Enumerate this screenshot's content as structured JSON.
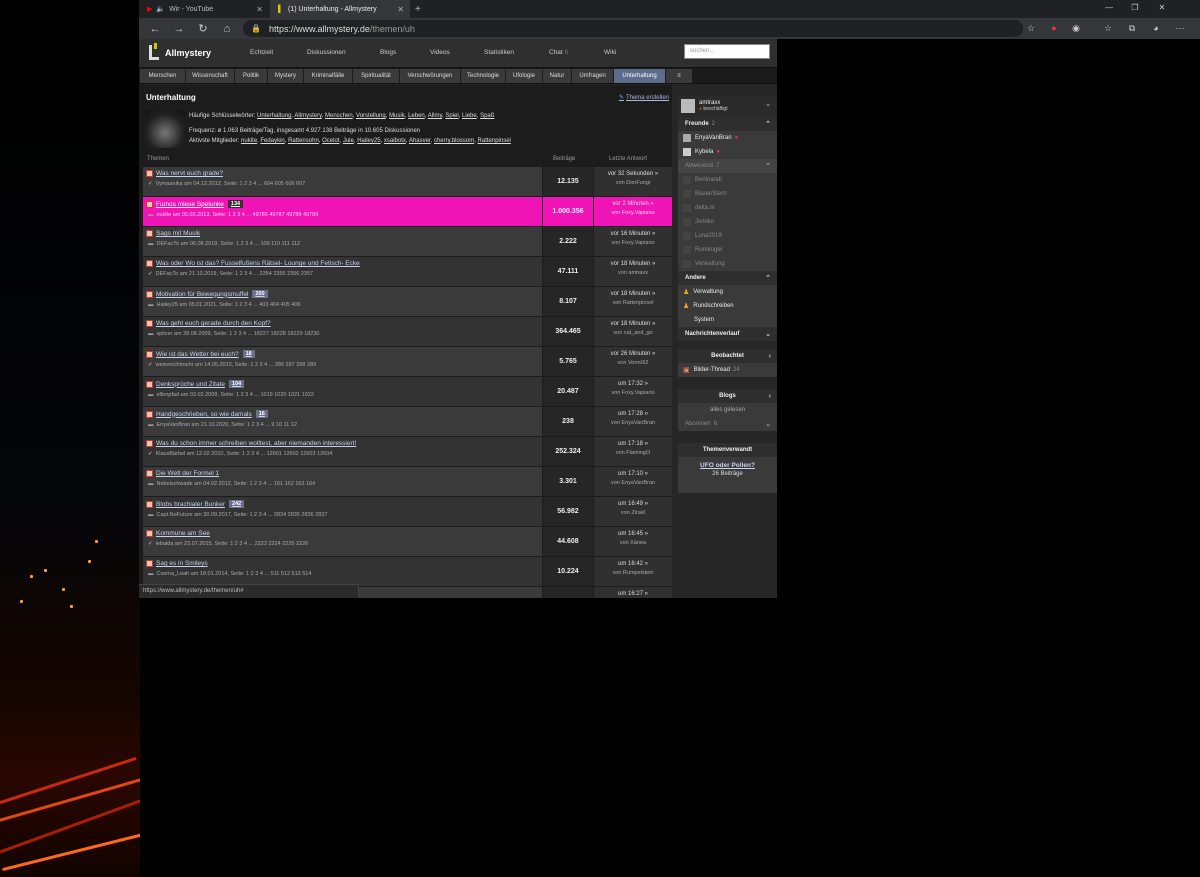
{
  "browser": {
    "tabs": [
      {
        "label": "Wir - YouTube"
      },
      {
        "label": "(1) Unterhaltung - Allmystery"
      }
    ],
    "url_host": "https://www.allmystery.de",
    "url_path": "/themen/uh",
    "status_url": "https://www.allmystery.de/themen/uh#"
  },
  "site": {
    "logo": "Allmystery",
    "topnav": [
      "Echtzeit",
      "Diskussionen",
      "Blogs",
      "Videos",
      "Statistiken",
      "Chat",
      "Wiki"
    ],
    "chat_count": "6",
    "search_placeholder": "suchen...",
    "categories": [
      "Menschen",
      "Wissenschaft",
      "Politik",
      "Mystery",
      "Kriminalfälle",
      "Spiritualität",
      "Verschwörungen",
      "Technologie",
      "Ufologie",
      "Natur",
      "Umfragen",
      "Unterhaltung",
      "≡"
    ],
    "active_category": "Unterhaltung"
  },
  "main": {
    "title": "Unterhaltung",
    "create_topic": "Thema erstellen",
    "keywords_label": "Häufige Schlüsselwörter:",
    "keywords": [
      "Unterhaltung",
      "Allmystery",
      "Menschen",
      "Vorstellung",
      "Musik",
      "Leben",
      "Allmy",
      "Spiel",
      "Liebe",
      "Spaß"
    ],
    "frequency_line": "Frequenz: ø 1.063 Beiträge/Tag, insgesamt 4.927.138 Beiträge in 10.605 Diskussionen",
    "active_label": "Aktivste Mitglieder:",
    "active_members": [
      "nukite",
      "Fedaykin",
      "Rattensohn",
      "Ocelot",
      "Jule",
      "Hailey25",
      "xsaibotx",
      "Ahasver",
      "cherry.blossom",
      "Rattenpinsel"
    ],
    "col_topics": "Themen",
    "col_posts": "Beiträge",
    "col_last": "Letzte Antwort",
    "rows": [
      {
        "title": "Was nervt euch grade?",
        "badge": "",
        "meta": "Vymaanika am 04.12.2012, Seite: 1 2 3 4 ... 604 605 606 607",
        "count": "12.135",
        "last": "vor 32 Sekunden »",
        "by": "von DonFungi"
      },
      {
        "title": "Fumos miese Spelunke",
        "badge": "134",
        "meta": "nukite am 05.02.2013, Seite: 1 2 3 4 ... 49786 49787 49788 49789",
        "count": "1.000.356",
        "last": "vor 2 Minuten »",
        "by": "von Foxy.Vapiano"
      },
      {
        "title": "Sags mit Musik",
        "badge": "",
        "meta": "DEFacTo am 06.08.2019, Seite: 1 2 3 4 ... 109 110 111 112",
        "count": "2.222",
        "last": "vor 16 Minuten »",
        "by": "von Foxy.Vapiano"
      },
      {
        "title": "Was oder Wo ist das? Fusselfußens Rätsel- Lounge und Fetisch- Ecke",
        "badge": "",
        "meta": "DEFacTo am 21.10.2019, Seite: 1 2 3 4 ... 2354 2355 2356 2357",
        "count": "47.111",
        "last": "vor 18 Minuten »",
        "by": "von amtraxx"
      },
      {
        "title": "Motivation für Bewegungsmuffel",
        "badge": "200",
        "meta": "Hailey25 am 05.01.2021, Seite: 1 2 3 4 ... 403 404 405 406",
        "count": "8.107",
        "last": "vor 18 Minuten »",
        "by": "von Rattenpinsel"
      },
      {
        "title": "Was geht euch gerade durch den Kopf?",
        "badge": "",
        "meta": "splicer am 28.08.2009, Seite: 1 2 3 4 ... 18227 18228 18229 18230",
        "count": "364.465",
        "last": "vor 18 Minuten »",
        "by": "von cat_and_go"
      },
      {
        "title": "Wie ist das Wetter bei euch?",
        "badge": "18",
        "meta": "weissnichtmehr am 14.05.2013, Seite: 1 2 3 4 ... 286 287 288 289",
        "count": "5.765",
        "last": "vor 26 Minuten »",
        "by": "von Vornü62"
      },
      {
        "title": "Denksprüche und Zitate",
        "badge": "104",
        "meta": "elfenpfad am 03.02.2008, Seite: 1 2 3 4 ... 1019 1020 1021 1022",
        "count": "20.487",
        "last": "um 17:32 »",
        "by": "von Foxy.Vapiano"
      },
      {
        "title": "Handgeschrieben, so wie damals",
        "badge": "16",
        "meta": "EnyaVanBran am 21.10.2020, Seite: 1 2 3 4 ... 9 10 11 12",
        "count": "238",
        "last": "um 17:28 »",
        "by": "von EnyaVanBran"
      },
      {
        "title": "Was du schon immer schreiben wolltest, aber niemanden interessiert!",
        "badge": "",
        "meta": "KlausBärbel am 12.02.2010, Seite: 1 2 3 4 ... 12601 12602 12603 12604",
        "count": "252.324",
        "last": "um 17:18 »",
        "by": "von FlamingO"
      },
      {
        "title": "Die Welt der Formel 1",
        "badge": "",
        "meta": "Nebelschwade am 04.02.2012, Seite: 1 2 3 4 ... 161 162 163 164",
        "count": "3.301",
        "last": "um 17:10 »",
        "by": "von EnyaVanBran"
      },
      {
        "title": "Blobs brachialer Bunker",
        "badge": "242",
        "meta": "Capt.NoFuture am 30.09.2017, Seite: 1 2 3 4 ... 2834 2835 2836 2837",
        "count": "56.982",
        "last": "um 16:49 »",
        "by": "von Ziraël"
      },
      {
        "title": "Kommune am See",
        "badge": "",
        "meta": "lebalda am 23.07.2015, Seite: 1 2 3 4 ... 2223 2224 2225 2226",
        "count": "44.608",
        "last": "um 16:45 »",
        "by": "von Xánea"
      },
      {
        "title": "Sag es in Smileys",
        "badge": "",
        "meta": "Cosma_Leah am 18.01.2014, Seite: 1 2 3 4 ... 511 512 513 514",
        "count": "10.224",
        "last": "um 16:42 »",
        "by": "von Rumpelstein"
      },
      {
        "title": "",
        "badge": "",
        "meta": "",
        "count": "",
        "last": "um 16:27 »",
        "by": ""
      }
    ]
  },
  "sidebar": {
    "user_name": "amtraxx",
    "user_status": "beschäftigt",
    "friends_label": "Freunde",
    "friends_count": "2",
    "friends": [
      "EnyaVanBran",
      "Kybela"
    ],
    "away_label": "Abwesend",
    "away_count": "7",
    "away": [
      "Berlinandi",
      "BlauerStern",
      "delta.m",
      "Jomiko",
      "Luna2019",
      "Rumkugel",
      "Verwaltung"
    ],
    "other_label": "Andere",
    "other": [
      "Verwaltung",
      "Rundschreiben",
      "System"
    ],
    "history_label": "Nachrichtenverlauf",
    "watched_label": "Beobachtet",
    "watched_item": "Bilder-Thread",
    "watched_count": "24",
    "blogs_label": "Blogs",
    "blogs_read": "alles gelesen",
    "subscribed_label": "Abonniert",
    "subscribed_count": "6",
    "related_label": "Themenverwandt",
    "related_title": "UFO oder Pollen?",
    "related_posts": "26 Beiträge"
  }
}
